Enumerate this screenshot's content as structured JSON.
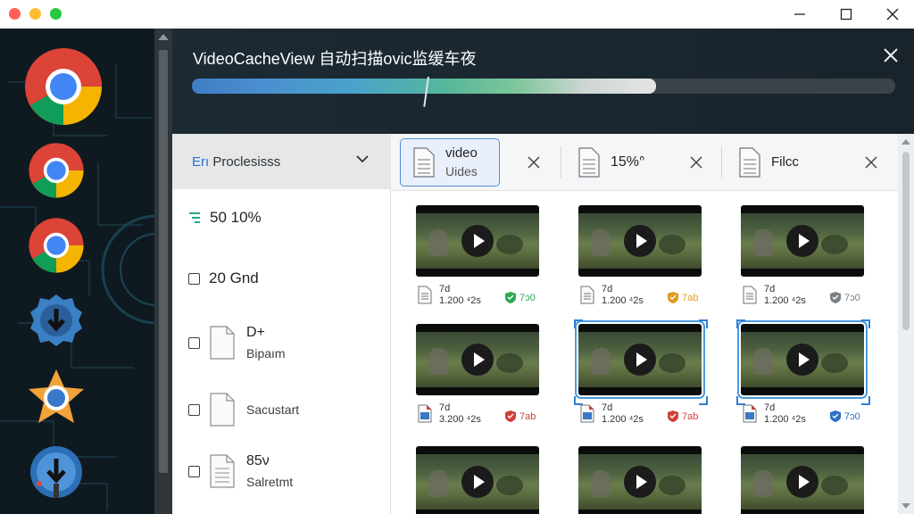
{
  "window": {
    "controls": [
      "minimize",
      "maximize",
      "close"
    ]
  },
  "dock": {
    "icons": [
      "chrome-icon",
      "chrome-icon",
      "chrome-icon",
      "download-gear-icon",
      "star-browser-icon",
      "globe-download-icon"
    ]
  },
  "header": {
    "title": "VideoCacheView 自动扫描ovic监缓车夜",
    "progress": 0.66
  },
  "filter": {
    "dropdown_prefix": "Erı",
    "dropdown_label": "Proclesisss",
    "items": [
      {
        "text": "50 10%",
        "type": "list"
      },
      {
        "text": "20 Gnd",
        "type": "checkbox"
      },
      {
        "line1": "D+",
        "line2": "Bipaım",
        "type": "checkbox-doc"
      },
      {
        "line1": "Sacustart",
        "type": "checkbox-doc"
      },
      {
        "line1": "85ν",
        "line2": "Salretmt",
        "type": "checkbox-doc"
      }
    ]
  },
  "tabs": [
    {
      "line1": "video",
      "line2": "Uides"
    },
    {
      "line1": "15%ᐢ"
    },
    {
      "line1": "Filcc"
    }
  ],
  "grid": {
    "cards": [
      {
        "m1": "7d",
        "m2": "1.200 ⁴2s",
        "badge": "7ɔ0",
        "badge_color": "#2eaa52"
      },
      {
        "m1": "7d",
        "m2": "1.200 ⁴2s",
        "badge": "7ab",
        "badge_color": "#e09a1c"
      },
      {
        "m1": "7d",
        "m2": "1.200 ⁴2s",
        "badge": "7ɔ0",
        "badge_color": "#7a8086"
      },
      {
        "m1": "7d",
        "m2": "3.200 ⁴2s",
        "badge": "7ab",
        "badge_color": "#d0403a"
      },
      {
        "m1": "7d",
        "m2": "1.200 ⁴2s",
        "badge": "7ab",
        "badge_color": "#d0403a"
      },
      {
        "m1": "7d",
        "m2": "1.200 ⁴2s",
        "badge": "7ɔ0",
        "badge_color": "#2f6fc4"
      },
      {},
      {},
      {}
    ]
  }
}
